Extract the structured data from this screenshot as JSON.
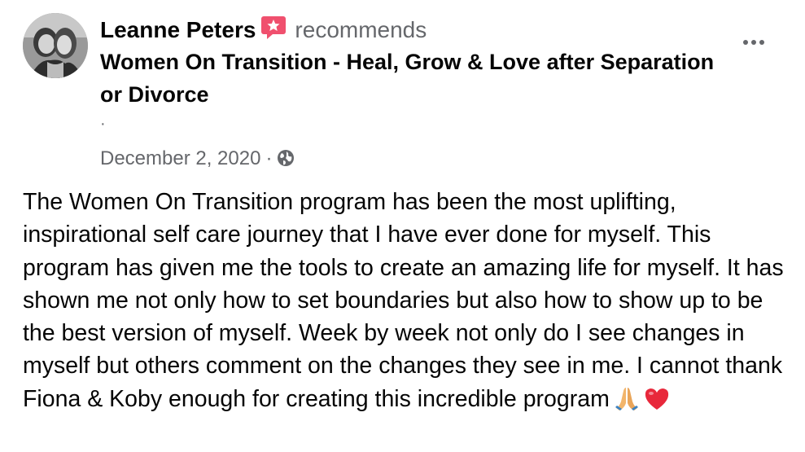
{
  "post": {
    "author": "Leanne Peters",
    "action": "recommends",
    "page_name": "Women On Transition - Heal, Grow & Love after Separation or Divorce",
    "separator": "·",
    "date": "December 2, 2020",
    "meta_separator": "·",
    "privacy_icon": "globe-icon",
    "recommend_icon": "recommend-badge-icon",
    "more_icon": "more-options-icon",
    "body": "The Women On Transition program has been the most uplifting, inspirational self care journey that I have ever done for myself. This program has given me the tools to create an amazing life for myself. It has shown me not only how to set boundaries but also how to show up to be the best version of myself. Week by week not only do I see changes in myself but others comment on the changes they see in me. I cannot thank Fiona & Koby enough for creating this incredible program",
    "emojis": [
      "praying-hands-emoji",
      "red-heart-emoji"
    ]
  },
  "colors": {
    "text_primary": "#050505",
    "text_secondary": "#65676b",
    "recommend_badge": "#f0506e",
    "heart": "#e8283b",
    "background": "#ffffff"
  }
}
